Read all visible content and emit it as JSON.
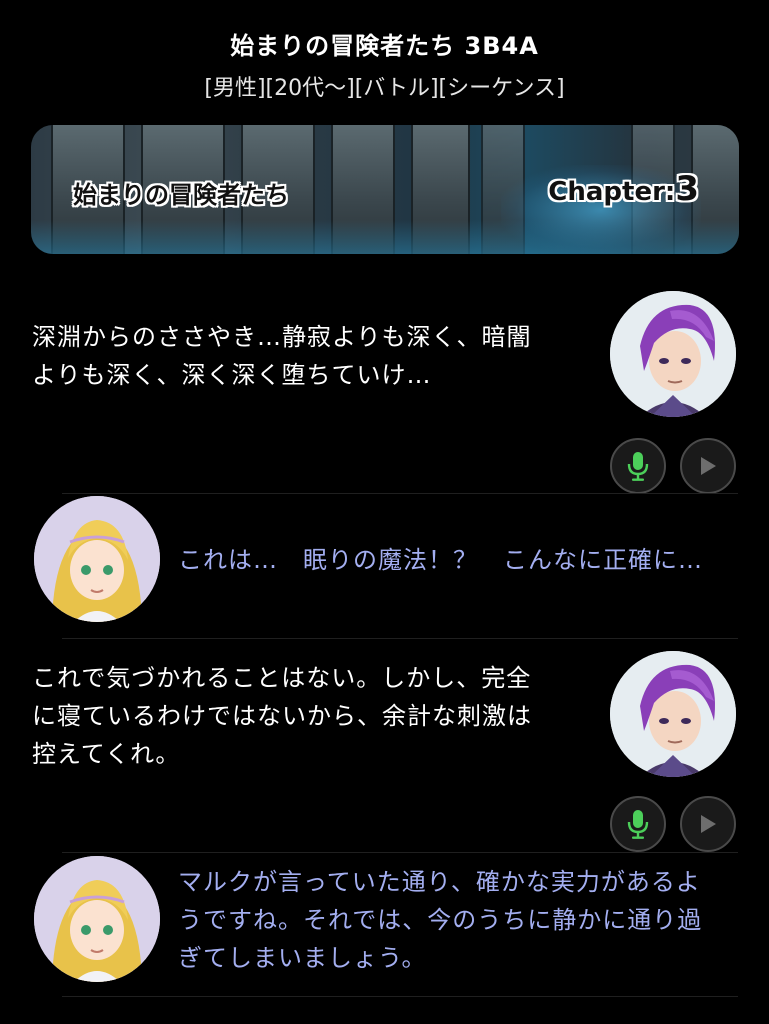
{
  "header": {
    "title": "始まりの冒険者たち  3B4A",
    "tags": "[男性][20代〜][バトル][シーケンス]"
  },
  "banner": {
    "title": "始まりの冒険者たち",
    "chapter_label": "Chapter:",
    "chapter_number": "3"
  },
  "messages": [
    {
      "speaker": "marc",
      "lines": [
        "深淵からのささやき…静寂よりも深く、暗闇",
        "よりも深く、深く深く堕ちていけ…"
      ]
    },
    {
      "speaker": "girl",
      "lines": [
        "これは…　眠りの魔法！？　こんなに正確に…"
      ]
    },
    {
      "speaker": "marc",
      "lines": [
        "これで気づかれることはない。しかし、完全",
        "に寝ているわけではないから、余計な刺激は",
        "控えてくれ。"
      ]
    },
    {
      "speaker": "girl",
      "lines": [
        "マルクが言っていた通り、確かな実力があるよ",
        "うですね。それでは、今のうちに静かに通り過",
        "ぎてしまいましょう。"
      ]
    }
  ],
  "icons": {
    "mic": "microphone-icon",
    "play": "play-icon"
  },
  "colors": {
    "background": "#000000",
    "self_text": "#ffffff",
    "other_text": "#a3aef0",
    "mic_green": "#4ccf5a",
    "play_gray": "#6d6d6d"
  }
}
